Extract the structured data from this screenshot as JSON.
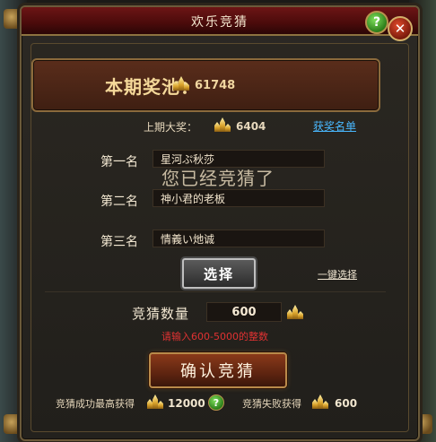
{
  "window": {
    "title": "欢乐竞猜",
    "help_glyph": "?",
    "close_glyph": "✕"
  },
  "pool": {
    "label": "本期奖池：",
    "value": "61748",
    "icon": "gold-crystal-icon"
  },
  "last_prize": {
    "label": "上期大奖：",
    "value": "6404",
    "winner_list_link": "获奖名单"
  },
  "ranks": [
    {
      "label": "第一名",
      "value": "星河ぷ秋莎"
    },
    {
      "label": "第二名",
      "value": "神小君的老板"
    },
    {
      "label": "第三名",
      "value": "情義い灺诚"
    }
  ],
  "status_overlay": "您已经竞猜了",
  "select_button": "选择",
  "one_key_select": "一键选择",
  "quantity": {
    "label": "竞猜数量",
    "value": "600",
    "hint": "请输入600-5000的整数"
  },
  "confirm_button": "确认竞猜",
  "footer": {
    "success_label": "竞猜成功最高获得",
    "success_value": "12000",
    "fail_label": "竞猜失败获得",
    "fail_value": "600",
    "help_glyph": "?"
  },
  "colors": {
    "title_bar": "#6d1515",
    "link": "#49b8ff",
    "hint": "#e03232",
    "gold": "#d8a12a"
  }
}
